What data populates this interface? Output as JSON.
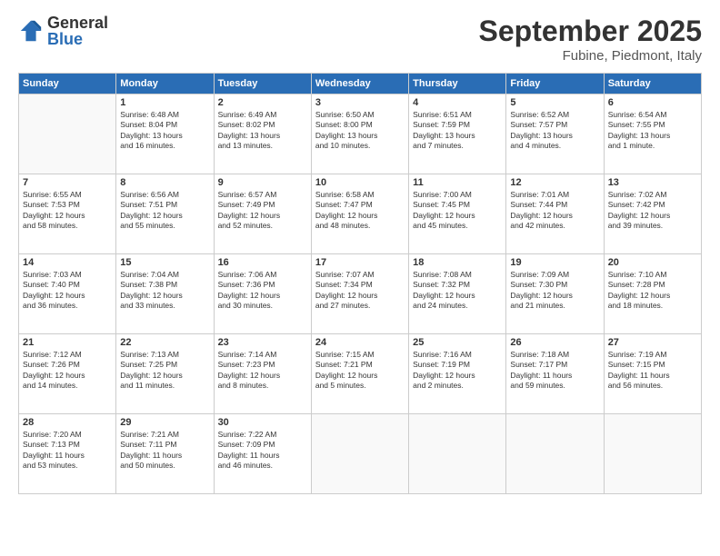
{
  "logo": {
    "general": "General",
    "blue": "Blue"
  },
  "title": "September 2025",
  "subtitle": "Fubine, Piedmont, Italy",
  "days_of_week": [
    "Sunday",
    "Monday",
    "Tuesday",
    "Wednesday",
    "Thursday",
    "Friday",
    "Saturday"
  ],
  "weeks": [
    [
      {
        "day": "",
        "info": ""
      },
      {
        "day": "1",
        "info": "Sunrise: 6:48 AM\nSunset: 8:04 PM\nDaylight: 13 hours\nand 16 minutes."
      },
      {
        "day": "2",
        "info": "Sunrise: 6:49 AM\nSunset: 8:02 PM\nDaylight: 13 hours\nand 13 minutes."
      },
      {
        "day": "3",
        "info": "Sunrise: 6:50 AM\nSunset: 8:00 PM\nDaylight: 13 hours\nand 10 minutes."
      },
      {
        "day": "4",
        "info": "Sunrise: 6:51 AM\nSunset: 7:59 PM\nDaylight: 13 hours\nand 7 minutes."
      },
      {
        "day": "5",
        "info": "Sunrise: 6:52 AM\nSunset: 7:57 PM\nDaylight: 13 hours\nand 4 minutes."
      },
      {
        "day": "6",
        "info": "Sunrise: 6:54 AM\nSunset: 7:55 PM\nDaylight: 13 hours\nand 1 minute."
      }
    ],
    [
      {
        "day": "7",
        "info": "Sunrise: 6:55 AM\nSunset: 7:53 PM\nDaylight: 12 hours\nand 58 minutes."
      },
      {
        "day": "8",
        "info": "Sunrise: 6:56 AM\nSunset: 7:51 PM\nDaylight: 12 hours\nand 55 minutes."
      },
      {
        "day": "9",
        "info": "Sunrise: 6:57 AM\nSunset: 7:49 PM\nDaylight: 12 hours\nand 52 minutes."
      },
      {
        "day": "10",
        "info": "Sunrise: 6:58 AM\nSunset: 7:47 PM\nDaylight: 12 hours\nand 48 minutes."
      },
      {
        "day": "11",
        "info": "Sunrise: 7:00 AM\nSunset: 7:45 PM\nDaylight: 12 hours\nand 45 minutes."
      },
      {
        "day": "12",
        "info": "Sunrise: 7:01 AM\nSunset: 7:44 PM\nDaylight: 12 hours\nand 42 minutes."
      },
      {
        "day": "13",
        "info": "Sunrise: 7:02 AM\nSunset: 7:42 PM\nDaylight: 12 hours\nand 39 minutes."
      }
    ],
    [
      {
        "day": "14",
        "info": "Sunrise: 7:03 AM\nSunset: 7:40 PM\nDaylight: 12 hours\nand 36 minutes."
      },
      {
        "day": "15",
        "info": "Sunrise: 7:04 AM\nSunset: 7:38 PM\nDaylight: 12 hours\nand 33 minutes."
      },
      {
        "day": "16",
        "info": "Sunrise: 7:06 AM\nSunset: 7:36 PM\nDaylight: 12 hours\nand 30 minutes."
      },
      {
        "day": "17",
        "info": "Sunrise: 7:07 AM\nSunset: 7:34 PM\nDaylight: 12 hours\nand 27 minutes."
      },
      {
        "day": "18",
        "info": "Sunrise: 7:08 AM\nSunset: 7:32 PM\nDaylight: 12 hours\nand 24 minutes."
      },
      {
        "day": "19",
        "info": "Sunrise: 7:09 AM\nSunset: 7:30 PM\nDaylight: 12 hours\nand 21 minutes."
      },
      {
        "day": "20",
        "info": "Sunrise: 7:10 AM\nSunset: 7:28 PM\nDaylight: 12 hours\nand 18 minutes."
      }
    ],
    [
      {
        "day": "21",
        "info": "Sunrise: 7:12 AM\nSunset: 7:26 PM\nDaylight: 12 hours\nand 14 minutes."
      },
      {
        "day": "22",
        "info": "Sunrise: 7:13 AM\nSunset: 7:25 PM\nDaylight: 12 hours\nand 11 minutes."
      },
      {
        "day": "23",
        "info": "Sunrise: 7:14 AM\nSunset: 7:23 PM\nDaylight: 12 hours\nand 8 minutes."
      },
      {
        "day": "24",
        "info": "Sunrise: 7:15 AM\nSunset: 7:21 PM\nDaylight: 12 hours\nand 5 minutes."
      },
      {
        "day": "25",
        "info": "Sunrise: 7:16 AM\nSunset: 7:19 PM\nDaylight: 12 hours\nand 2 minutes."
      },
      {
        "day": "26",
        "info": "Sunrise: 7:18 AM\nSunset: 7:17 PM\nDaylight: 11 hours\nand 59 minutes."
      },
      {
        "day": "27",
        "info": "Sunrise: 7:19 AM\nSunset: 7:15 PM\nDaylight: 11 hours\nand 56 minutes."
      }
    ],
    [
      {
        "day": "28",
        "info": "Sunrise: 7:20 AM\nSunset: 7:13 PM\nDaylight: 11 hours\nand 53 minutes."
      },
      {
        "day": "29",
        "info": "Sunrise: 7:21 AM\nSunset: 7:11 PM\nDaylight: 11 hours\nand 50 minutes."
      },
      {
        "day": "30",
        "info": "Sunrise: 7:22 AM\nSunset: 7:09 PM\nDaylight: 11 hours\nand 46 minutes."
      },
      {
        "day": "",
        "info": ""
      },
      {
        "day": "",
        "info": ""
      },
      {
        "day": "",
        "info": ""
      },
      {
        "day": "",
        "info": ""
      }
    ]
  ]
}
